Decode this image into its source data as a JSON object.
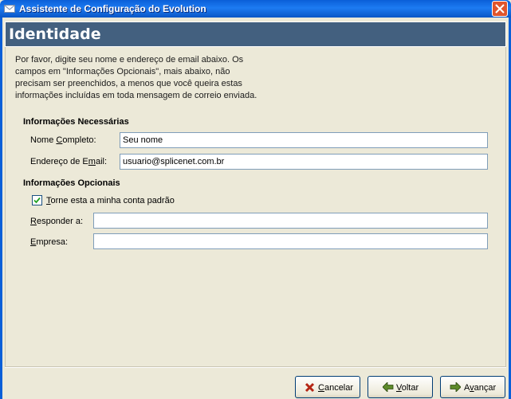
{
  "window": {
    "title": "Assistente de Configuração do Evolution"
  },
  "page": {
    "title": "Identidade",
    "intro_lines": [
      "Por favor, digite seu nome e endereço de email abaixo. Os",
      "campos em \"Informações Opcionais\", mais abaixo, não",
      "precisam ser preenchidos, a menos que você queira estas",
      "informações incluídas em toda mensagem de correio enviada."
    ]
  },
  "required": {
    "title": "Informações Necessárias",
    "full_name": {
      "label_pre": "Nome ",
      "label_key": "C",
      "label_post": "ompleto:",
      "value": "Seu nome"
    },
    "email": {
      "label_pre": "Endereço de E",
      "label_key": "m",
      "label_post": "ail:",
      "value": "usuario@splicenet.com.br"
    }
  },
  "optional": {
    "title": "Informações Opcionais",
    "default_account": {
      "label_key": "T",
      "label_post": "orne esta a minha conta padrão",
      "checked": true
    },
    "reply_to": {
      "label_key": "R",
      "label_post": "esponder a:",
      "value": ""
    },
    "company": {
      "label_key": "E",
      "label_post": "mpresa:",
      "value": ""
    }
  },
  "buttons": {
    "cancel": {
      "key": "C",
      "rest": "ancelar",
      "icon": "x-icon"
    },
    "back": {
      "key": "V",
      "rest": "oltar",
      "icon": "arrow-left-icon"
    },
    "forward": {
      "pre": "A",
      "key": "v",
      "rest": "ançar",
      "icon": "arrow-right-icon"
    }
  },
  "colors": {
    "titlebar": "#0a5fd8",
    "header_band": "#43607f",
    "dialog_bg": "#ece9d8",
    "close_button": "#e0552d"
  }
}
